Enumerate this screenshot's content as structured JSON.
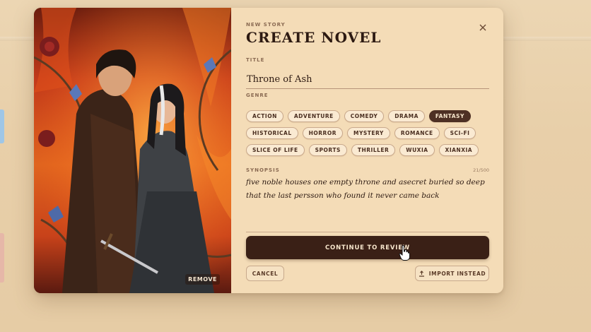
{
  "colors": {
    "page_bg": "#e8cfa9",
    "modal_bg": "#f4dcb7",
    "primary_dark": "#3a2016",
    "chip_selected": "#4e3024",
    "text_dark": "#2d1a12",
    "label_muted": "#8a6a52"
  },
  "cover": {
    "remove_label": "REMOVE"
  },
  "header": {
    "eyebrow": "NEW STORY",
    "title": "CREATE NOVEL",
    "close_icon": "close-icon"
  },
  "title_field": {
    "label": "TITLE",
    "value": "Throne of Ash"
  },
  "genre": {
    "label": "GENRE",
    "selected": "FANTASY",
    "rows": [
      [
        "ACTION",
        "ADVENTURE",
        "COMEDY",
        "DRAMA",
        "FANTASY"
      ],
      [
        "HISTORICAL",
        "HORROR",
        "MYSTERY",
        "ROMANCE",
        "SCI-FI"
      ],
      [
        "SLICE OF LIFE",
        "SPORTS",
        "THRILLER",
        "WUXIA",
        "XIANXIA"
      ]
    ]
  },
  "synopsis": {
    "label": "SYNOPSIS",
    "counter": "21/500",
    "text": "five noble houses one empty throne and asecret buried so deep that the last persson who found it never came back"
  },
  "actions": {
    "continue_label": "CONTINUE TO REVIEW",
    "cancel_label": "CANCEL",
    "import_label": "IMPORT INSTEAD",
    "import_icon": "upload-icon"
  }
}
